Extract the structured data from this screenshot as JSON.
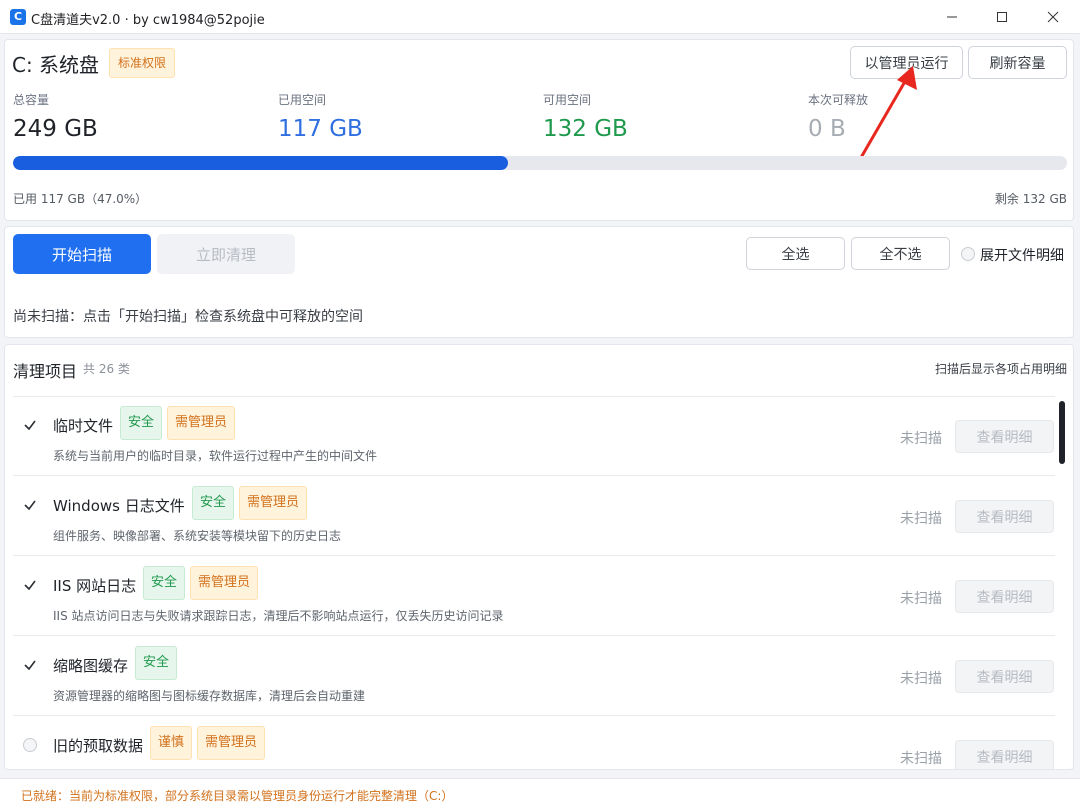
{
  "window": {
    "title": "C盘清道夫v2.0 · by cw1984@52pojie",
    "icon_letter": "C"
  },
  "drive": {
    "name": "C: 系统盘",
    "permission_tag": "标准权限",
    "run_as_admin_label": "以管理员运行",
    "refresh_label": "刷新容量"
  },
  "stats": {
    "total_label": "总容量",
    "total_value": "249 GB",
    "used_label": "已用空间",
    "used_value": "117 GB",
    "free_label": "可用空间",
    "free_value": "132 GB",
    "releasable_label": "本次可释放",
    "releasable_value": "0 B",
    "used_percent": 47.0,
    "used_summary": "已用 117 GB（47.0%）",
    "remaining_summary": "剩余 132 GB"
  },
  "colors": {
    "accent": "#1f6ff0",
    "used_value": "#2f6fe0",
    "free_value": "#1f9a4d",
    "releasable_value": "#a7acb3",
    "warning": "#d2711b"
  },
  "actions": {
    "scan_label": "开始扫描",
    "clean_label": "立即清理",
    "select_all_label": "全选",
    "select_none_label": "全不选",
    "expand_label": "展开文件明细"
  },
  "scan_status": "尚未扫描：点击「开始扫描」检查系统盘中可释放的空间",
  "items_section": {
    "title": "清理项目",
    "count": "共 26 类",
    "hint": "扫描后显示各项占用明细",
    "status_label": "未扫描",
    "detail_label": "查看明细",
    "items": [
      {
        "name": "临时文件",
        "checked": true,
        "tags": [
          {
            "text": "安全",
            "kind": "green"
          },
          {
            "text": "需管理员",
            "kind": "orange"
          }
        ],
        "desc": "系统与当前用户的临时目录，软件运行过程中产生的中间文件"
      },
      {
        "name": "Windows 日志文件",
        "checked": true,
        "tags": [
          {
            "text": "安全",
            "kind": "green"
          },
          {
            "text": "需管理员",
            "kind": "orange"
          }
        ],
        "desc": "组件服务、映像部署、系统安装等模块留下的历史日志"
      },
      {
        "name": "IIS 网站日志",
        "checked": true,
        "tags": [
          {
            "text": "安全",
            "kind": "green"
          },
          {
            "text": "需管理员",
            "kind": "orange"
          }
        ],
        "desc": "IIS 站点访问日志与失败请求跟踪日志，清理后不影响站点运行，仅丢失历史访问记录"
      },
      {
        "name": "缩略图缓存",
        "checked": true,
        "tags": [
          {
            "text": "安全",
            "kind": "green"
          }
        ],
        "desc": "资源管理器的缩略图与图标缓存数据库，清理后会自动重建"
      },
      {
        "name": "旧的预取数据",
        "checked": false,
        "tags": [
          {
            "text": "谨慎",
            "kind": "orange"
          },
          {
            "text": "需管理员",
            "kind": "orange"
          }
        ],
        "desc": ""
      }
    ]
  },
  "statusbar": "已就绪：当前为标准权限，部分系统目录需以管理员身份运行才能完整清理（C:）"
}
